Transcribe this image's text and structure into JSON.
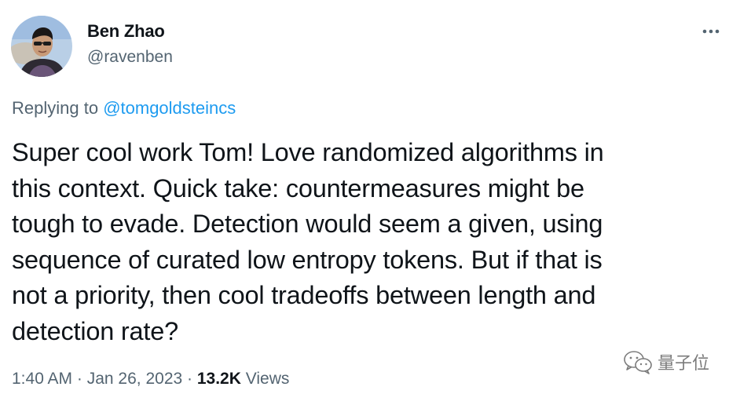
{
  "author": {
    "display_name": "Ben Zhao",
    "handle": "@ravenben",
    "avatar": "profile-photo"
  },
  "more_icon": "more-horizontal-icon",
  "reply": {
    "prefix": "Replying to ",
    "mention": "@tomgoldsteincs"
  },
  "tweet": {
    "lines": [
      "Super cool work Tom! Love randomized algorithms in",
      "this context. Quick take: countermeasures might be",
      "tough to evade. Detection would seem a given, using",
      "sequence of curated low entropy tokens. But if that is",
      "not a priority, then cool tradeoffs between length and",
      "detection rate?"
    ]
  },
  "meta": {
    "time": "1:40 AM",
    "separator": " · ",
    "date": "Jan 26, 2023",
    "views_count": "13.2K",
    "views_label": " Views"
  },
  "watermark": {
    "text": "量子位",
    "icon": "wechat-icon"
  },
  "colors": {
    "text": "#0f1419",
    "secondary": "#536471",
    "link": "#1d9bf0"
  }
}
